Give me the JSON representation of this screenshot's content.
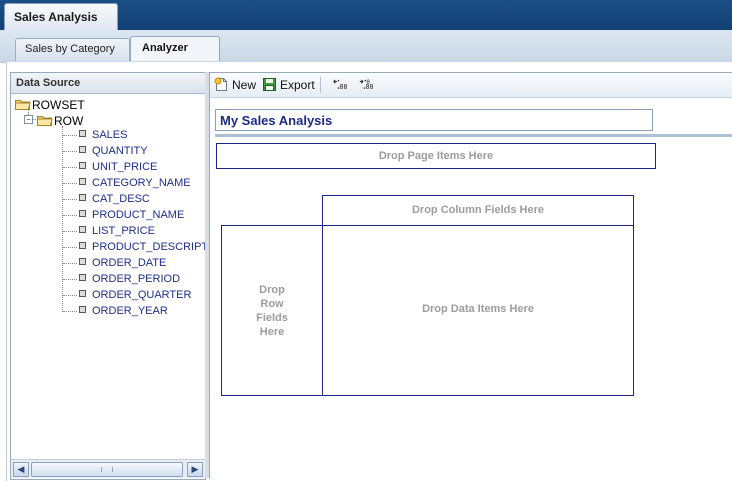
{
  "window": {
    "title": "Sales Analysis"
  },
  "tabs": [
    {
      "label": "Sales by Category",
      "active": false
    },
    {
      "label": "Analyzer",
      "active": true
    }
  ],
  "data_source": {
    "header": "Data Source",
    "root": "ROWSET",
    "child": "ROW",
    "fields": [
      "SALES",
      "QUANTITY",
      "UNIT_PRICE",
      "CATEGORY_NAME",
      "CAT_DESC",
      "PRODUCT_NAME",
      "LIST_PRICE",
      "PRODUCT_DESCRIPTIO",
      "ORDER_DATE",
      "ORDER_PERIOD",
      "ORDER_QUARTER",
      "ORDER_YEAR"
    ]
  },
  "toolbar": {
    "new_label": "New",
    "export_label": "Export"
  },
  "analysis": {
    "title": "My Sales Analysis",
    "drop_page": "Drop Page Items Here",
    "drop_column": "Drop Column Fields Here",
    "drop_row_lines": [
      "Drop",
      "Row",
      "Fields",
      "Here"
    ],
    "drop_data": "Drop Data Items Here"
  },
  "colors": {
    "header_bar": "#0f3c6e",
    "drop_border": "#1c2487",
    "field_text": "#1e2e8c",
    "placeholder_text": "#9c9c9c"
  },
  "icons": [
    "folder-icon",
    "new-icon",
    "export-icon",
    "decrease-decimal-icon",
    "increase-decimal-icon",
    "scroll-left-icon",
    "scroll-right-icon"
  ]
}
